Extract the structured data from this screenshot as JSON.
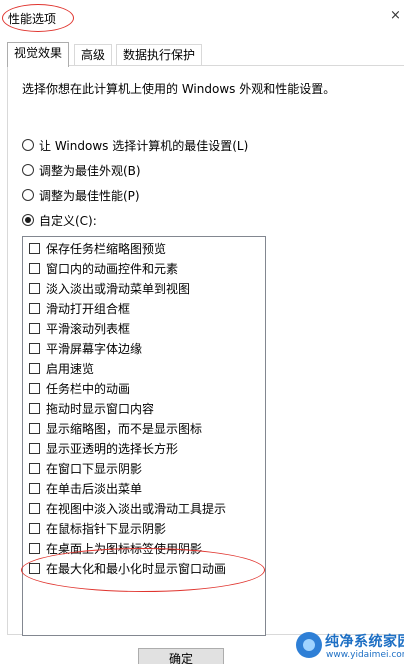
{
  "window": {
    "title": "性能选项",
    "close_glyph": "×"
  },
  "tabs": [
    {
      "label": "视觉效果",
      "active": true
    },
    {
      "label": "高级",
      "active": false
    },
    {
      "label": "数据执行保护",
      "active": false
    }
  ],
  "description": "选择你想在此计算机上使用的 Windows 外观和性能设置。",
  "radios": [
    {
      "label": "让 Windows 选择计算机的最佳设置(L)",
      "checked": false
    },
    {
      "label": "调整为最佳外观(B)",
      "checked": false
    },
    {
      "label": "调整为最佳性能(P)",
      "checked": false
    },
    {
      "label": "自定义(C):",
      "checked": true
    }
  ],
  "effects": [
    {
      "label": "保存任务栏缩略图预览",
      "checked": false
    },
    {
      "label": "窗口内的动画控件和元素",
      "checked": false
    },
    {
      "label": "淡入淡出或滑动菜单到视图",
      "checked": false
    },
    {
      "label": "滑动打开组合框",
      "checked": false
    },
    {
      "label": "平滑滚动列表框",
      "checked": false
    },
    {
      "label": "平滑屏幕字体边缘",
      "checked": false
    },
    {
      "label": "启用速览",
      "checked": false
    },
    {
      "label": "任务栏中的动画",
      "checked": false
    },
    {
      "label": "拖动时显示窗口内容",
      "checked": false
    },
    {
      "label": "显示缩略图，而不是显示图标",
      "checked": false
    },
    {
      "label": "显示亚透明的选择长方形",
      "checked": false
    },
    {
      "label": "在窗口下显示阴影",
      "checked": false
    },
    {
      "label": "在单击后淡出菜单",
      "checked": false
    },
    {
      "label": "在视图中淡入淡出或滑动工具提示",
      "checked": false
    },
    {
      "label": "在鼠标指针下显示阴影",
      "checked": false
    },
    {
      "label": "在桌面上为图标标签使用阴影",
      "checked": false
    },
    {
      "label": "在最大化和最小化时显示窗口动画",
      "checked": false
    }
  ],
  "buttons": {
    "ok_label": "确定"
  },
  "annotation_color": "#e0352f",
  "watermark": {
    "name": "纯净系统家园",
    "url": "www.yidaimei.com"
  }
}
